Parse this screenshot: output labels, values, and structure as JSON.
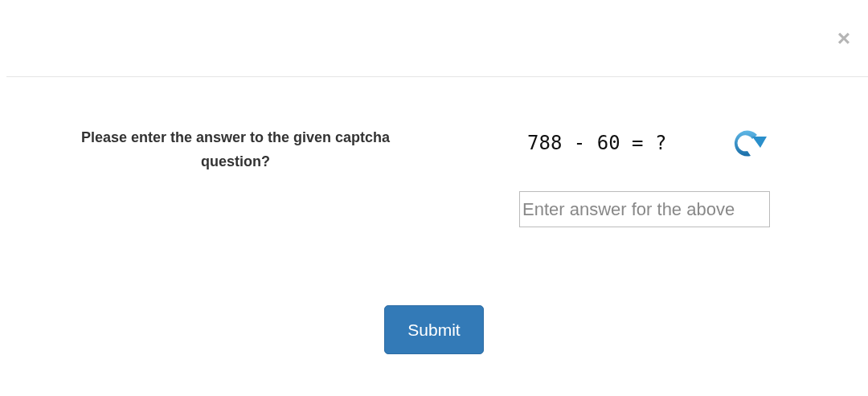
{
  "dialog": {
    "close": "×"
  },
  "prompt": "Please enter the answer to the given captcha question?",
  "captcha": {
    "question": "788 - 60 = ?"
  },
  "answer": {
    "placeholder": "Enter answer for the above"
  },
  "buttons": [
    "Submit"
  ]
}
